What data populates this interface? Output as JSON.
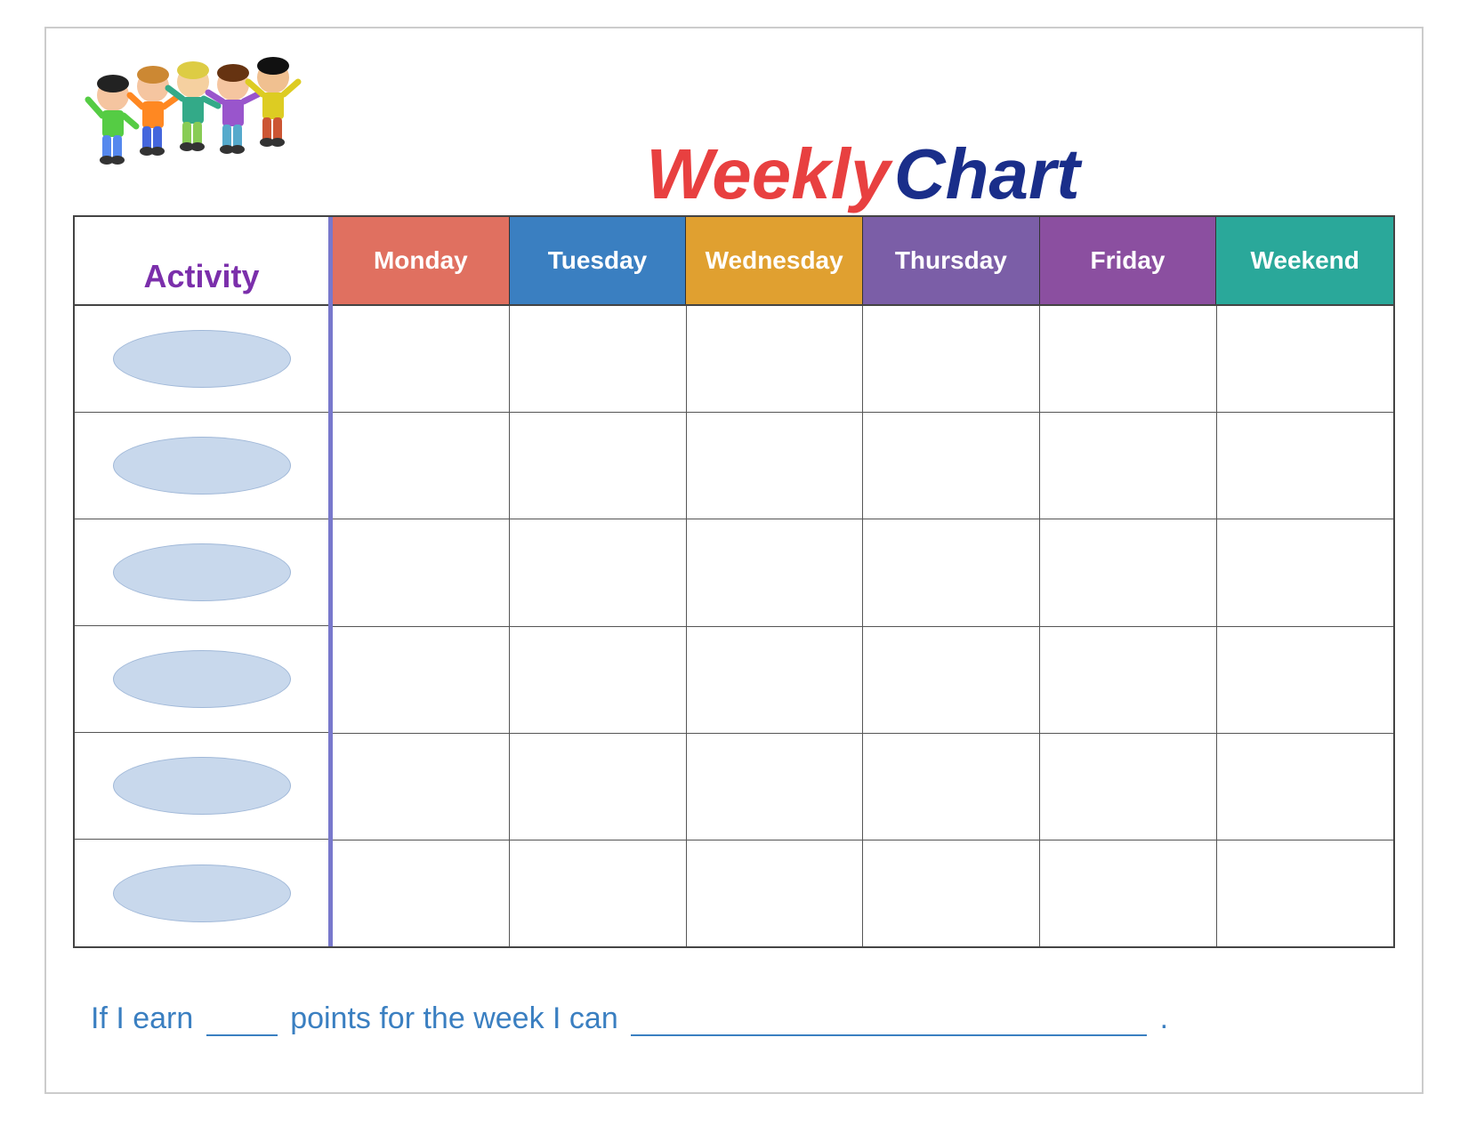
{
  "title": {
    "weekly": "Weekly",
    "chart": "Chart"
  },
  "header": {
    "activity_label": "Activity",
    "days": [
      {
        "id": "monday",
        "label": "Monday",
        "color": "#e07060"
      },
      {
        "id": "tuesday",
        "label": "Tuesday",
        "color": "#3a7fc1"
      },
      {
        "id": "wednesday",
        "label": "Wednesday",
        "color": "#e0a030"
      },
      {
        "id": "thursday",
        "label": "Thursday",
        "color": "#7b5ea7"
      },
      {
        "id": "friday",
        "label": "Friday",
        "color": "#8b4fa0"
      },
      {
        "id": "weekend",
        "label": "Weekend",
        "color": "#2aa89a"
      }
    ]
  },
  "rows": [
    {
      "id": 1
    },
    {
      "id": 2
    },
    {
      "id": 3
    },
    {
      "id": 4
    },
    {
      "id": 5
    },
    {
      "id": 6
    }
  ],
  "bottom": {
    "text_before": "If I earn",
    "blank1": "",
    "text_middle": "points for the week I can",
    "blank2": "",
    "period": "."
  }
}
